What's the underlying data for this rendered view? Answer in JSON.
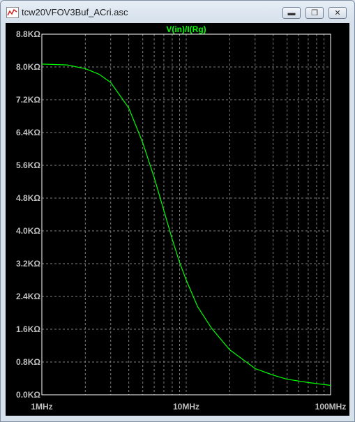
{
  "window": {
    "title": "tcw20VFOV3Buf_ACri.asc",
    "buttons": {
      "minimize": "▬",
      "restore": "❐",
      "close": "✕"
    }
  },
  "colors": {
    "trace": "#00ff00",
    "background": "#000000",
    "grid": "#808080",
    "axis_text": "#c0c0c0"
  },
  "chart_data": {
    "type": "line",
    "title": "V(in)/I(Rg)",
    "xscale": "log",
    "xlim": [
      1000000,
      100000000
    ],
    "ylim": [
      0,
      8800
    ],
    "y_ticks": [
      0,
      800,
      1600,
      2400,
      3200,
      4000,
      4800,
      5600,
      6400,
      7200,
      8000,
      8800
    ],
    "y_tick_labels": [
      "0.0KΩ",
      "0.8KΩ",
      "1.6KΩ",
      "2.4KΩ",
      "3.2KΩ",
      "4.0KΩ",
      "4.8KΩ",
      "5.6KΩ",
      "6.4KΩ",
      "7.2KΩ",
      "8.0KΩ",
      "8.8KΩ"
    ],
    "x_tick_labels": [
      "1MHz",
      "10MHz",
      "100MHz"
    ],
    "grid": true,
    "series": [
      {
        "name": "V(in)/I(Rg)",
        "x": [
          1000000,
          1500000,
          2000000,
          2500000,
          3000000,
          4000000,
          5000000,
          6000000,
          7000000,
          8000000,
          9000000,
          10000000,
          12000000,
          15000000,
          20000000,
          30000000,
          40000000,
          50000000,
          70000000,
          100000000
        ],
        "y": [
          8070,
          8050,
          7960,
          7820,
          7620,
          7000,
          6150,
          5300,
          4500,
          3800,
          3230,
          2800,
          2150,
          1620,
          1100,
          640,
          480,
          380,
          300,
          230
        ]
      }
    ]
  }
}
